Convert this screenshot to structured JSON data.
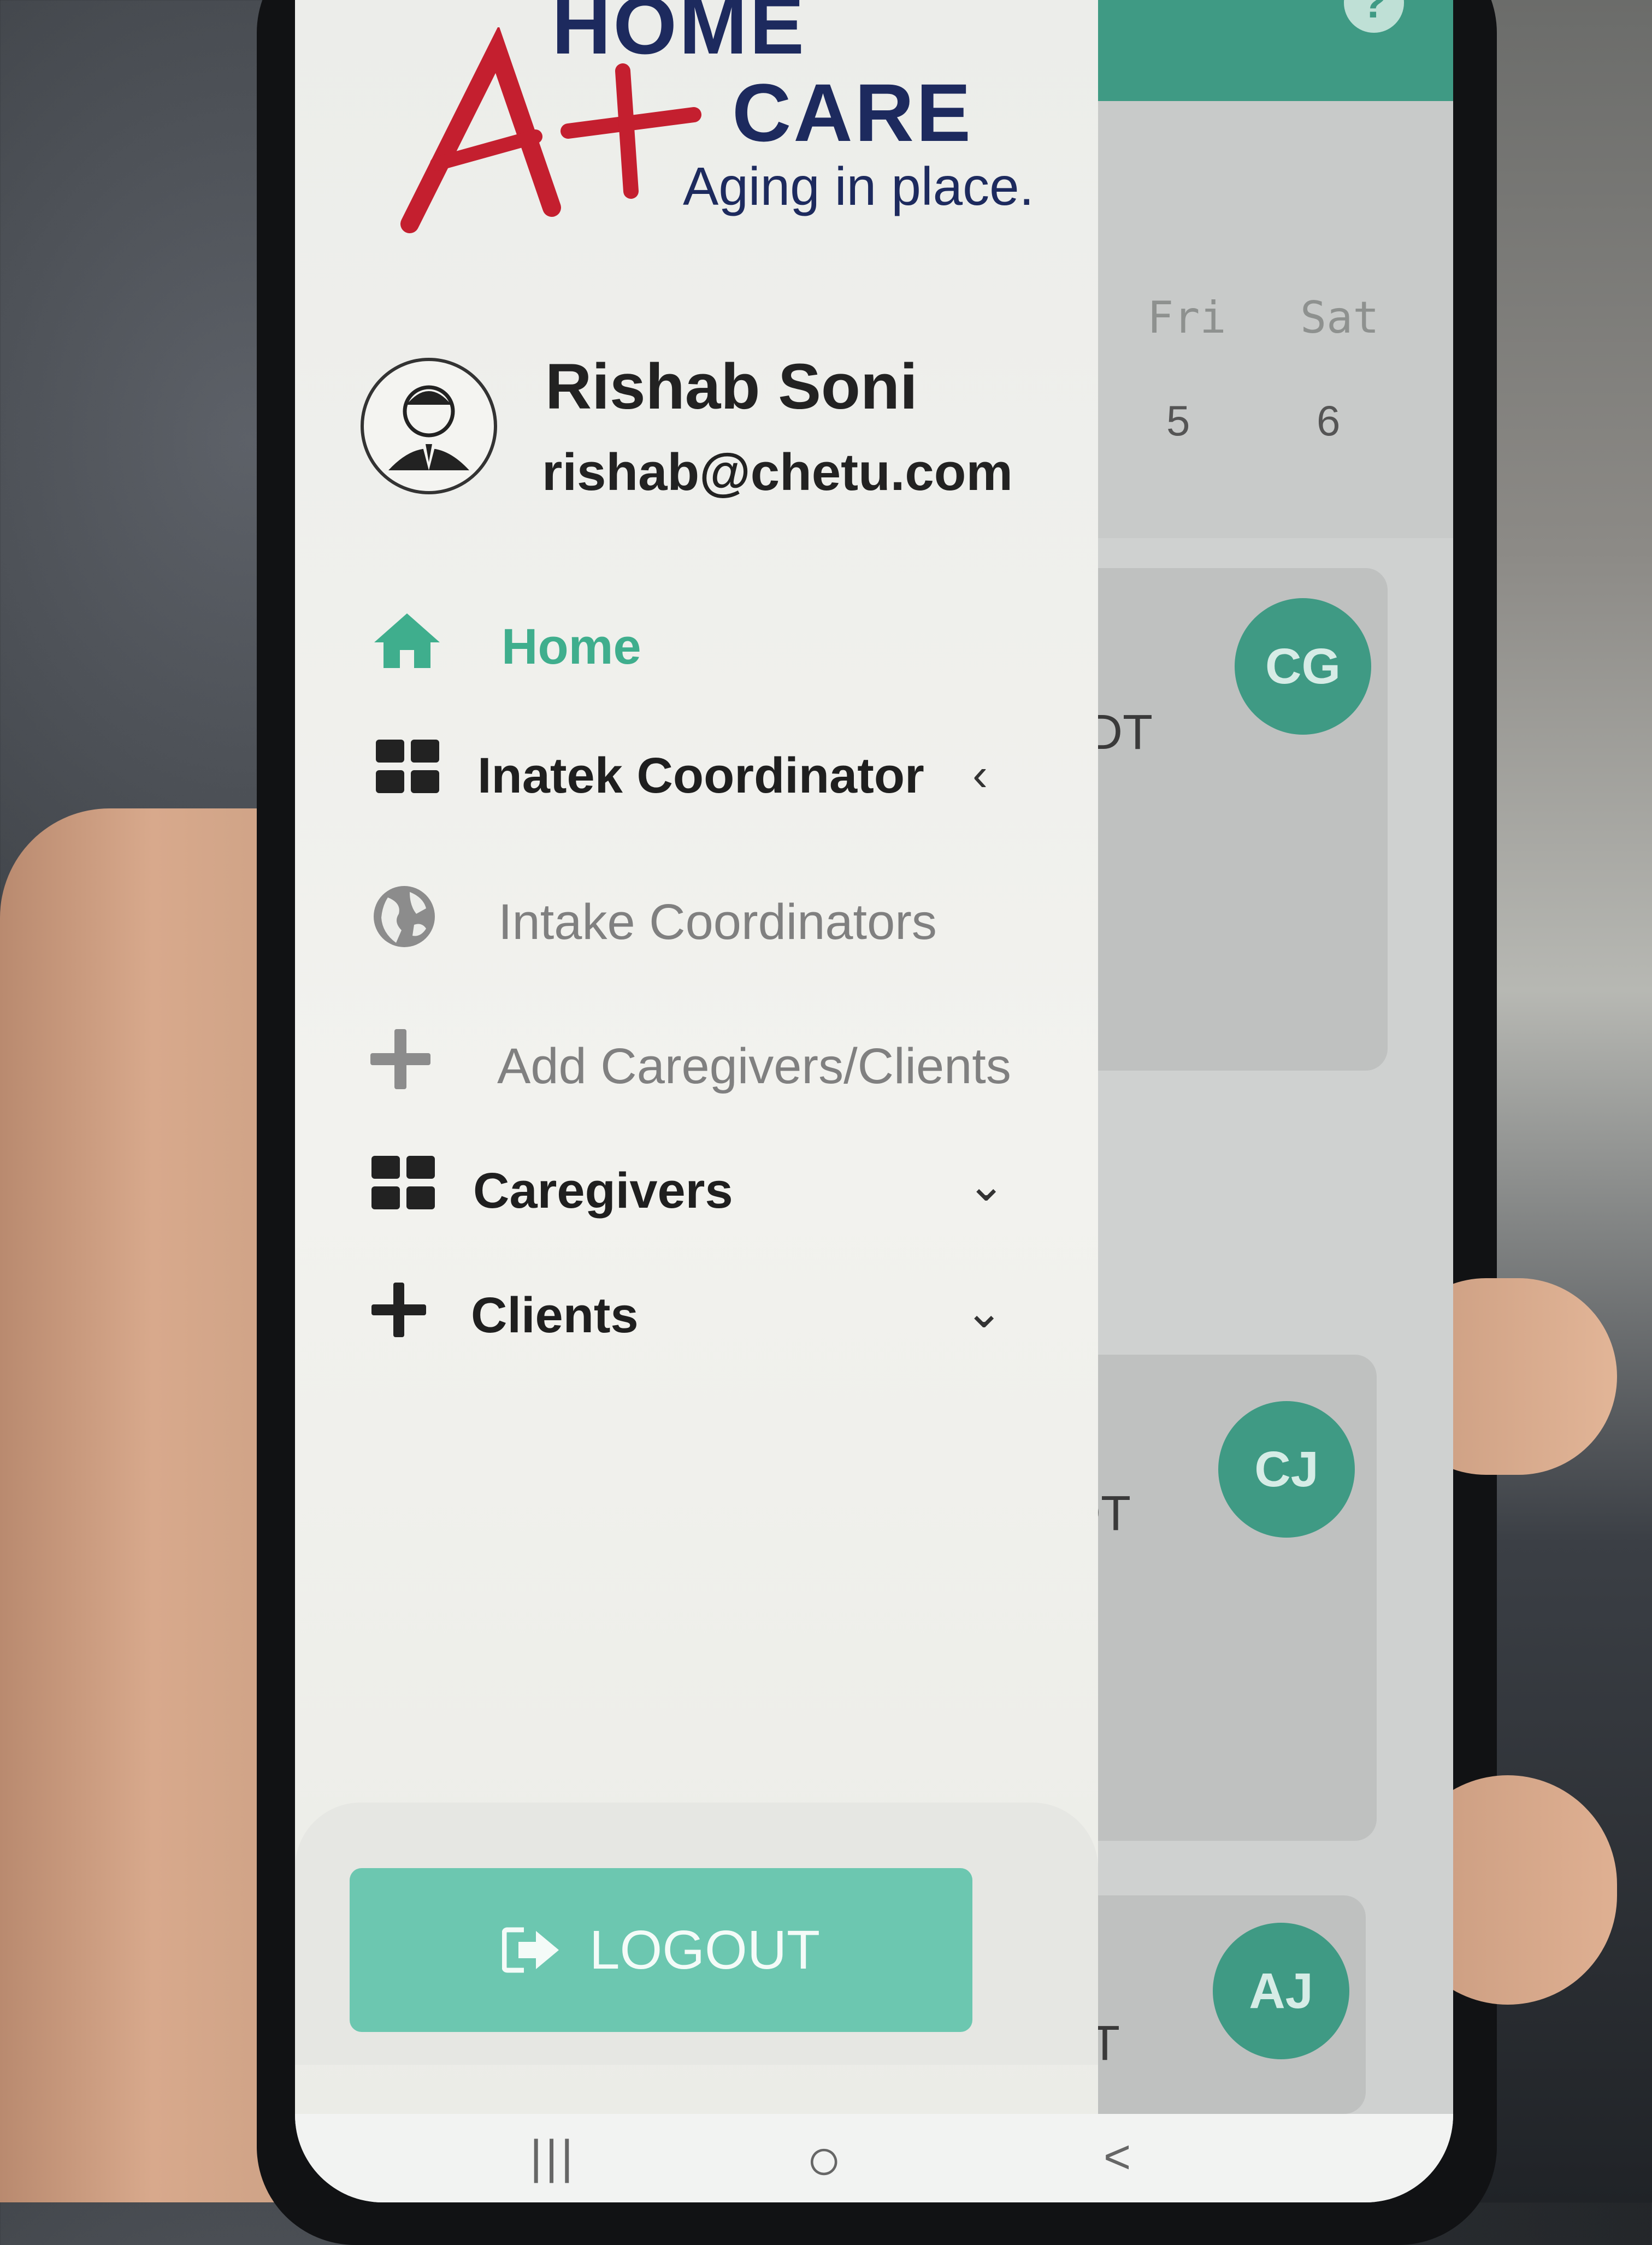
{
  "logo": {
    "line1": "HOME",
    "line2": "CARE",
    "tagline": "Aging in place.",
    "mark": "A+"
  },
  "profile": {
    "name": "Rishab Soni",
    "email": "rishab@chetu.com",
    "avatar_icon": "user-avatar-icon"
  },
  "menu": {
    "home": {
      "label": "Home",
      "icon": "home-icon"
    },
    "intake_coordinator": {
      "label": "Inatek Coordinator",
      "icon": "grid-icon",
      "chevron": "‹"
    },
    "intake_coordinators": {
      "label": "Intake Coordinators",
      "icon": "globe-icon"
    },
    "add_caregivers_clients": {
      "label": "Add Caregivers/Clients",
      "icon": "plus-icon"
    },
    "caregivers": {
      "label": "Caregivers",
      "icon": "grid-icon",
      "chevron": "⌄"
    },
    "clients": {
      "label": "Clients",
      "icon": "plus-icon",
      "chevron": "⌄"
    }
  },
  "logout": {
    "label": "LOGOUT",
    "icon": "logout-icon"
  },
  "background_app": {
    "help": "?",
    "days": [
      {
        "label": "Fri",
        "num": "5"
      },
      {
        "label": "Sat",
        "num": "6"
      }
    ],
    "cards": [
      {
        "initials": "CG",
        "text": "DT"
      },
      {
        "initials": "CJ",
        "text": "DT"
      },
      {
        "initials": "AJ",
        "text": "DT"
      }
    ]
  },
  "system_nav": {
    "recents": "|||",
    "home": "○",
    "back": "<"
  },
  "colors": {
    "accent": "#3fae8d",
    "header": "#3f9a84",
    "logout_button": "#6cc7b0",
    "brand_navy": "#1d2a5e",
    "brand_red": "#c41f2f"
  }
}
